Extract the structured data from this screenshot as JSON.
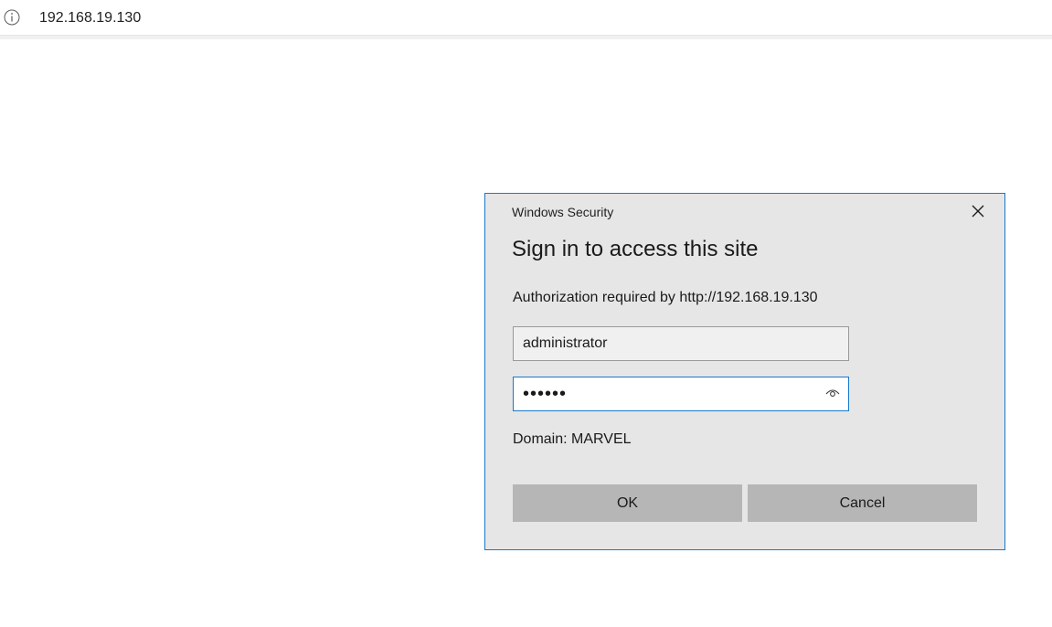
{
  "browser": {
    "url": "192.168.19.130",
    "info_icon": "info-circle-icon"
  },
  "dialog": {
    "caption": "Windows Security",
    "title": "Sign in to access this site",
    "authorization_text": "Authorization required by http://192.168.19.130",
    "username_value": "administrator",
    "password_value": "123456",
    "domain_text": "Domain: MARVEL",
    "ok_label": "OK",
    "cancel_label": "Cancel",
    "close_icon": "close-icon",
    "reveal_icon": "eye-icon"
  },
  "colors": {
    "dialog_background": "#e6e6e6",
    "dialog_border": "#1979ca",
    "button_background": "#b6b6b6",
    "focused_field_border": "#1979ca"
  }
}
